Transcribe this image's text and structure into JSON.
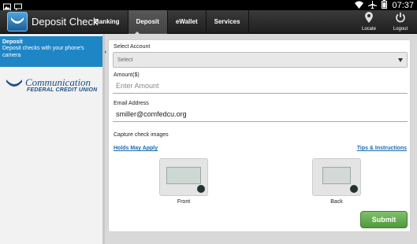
{
  "status_bar": {
    "time": "07:37"
  },
  "header": {
    "app_title": "Deposit Check",
    "tabs": [
      {
        "label": "Banking",
        "active": false
      },
      {
        "label": "Deposit",
        "active": true
      },
      {
        "label": "eWallet",
        "active": false
      },
      {
        "label": "Services",
        "active": false
      }
    ],
    "locate_label": "Locate",
    "logout_label": "Logout"
  },
  "sidebar": {
    "selected_title": "Deposit",
    "selected_desc": "Deposit checks with your phone's camera",
    "logo_name": "Communication",
    "logo_sub": "FEDERAL CREDIT UNION"
  },
  "form": {
    "account_label": "Select Account",
    "account_value": "Select",
    "amount_label": "Amount($)",
    "amount_placeholder": "Enter Amount",
    "email_label": "Email Address",
    "email_value": "smiller@comfedcu.org",
    "capture_label": "Capture check images",
    "holds_link": "Holds May Apply",
    "tips_link": "Tips & Instructions",
    "front_label": "Front",
    "back_label": "Back",
    "submit_label": "Submit"
  },
  "colors": {
    "accent": "#1f86c6",
    "submit_green": "#5fa84a",
    "link": "#1a6bb0"
  }
}
